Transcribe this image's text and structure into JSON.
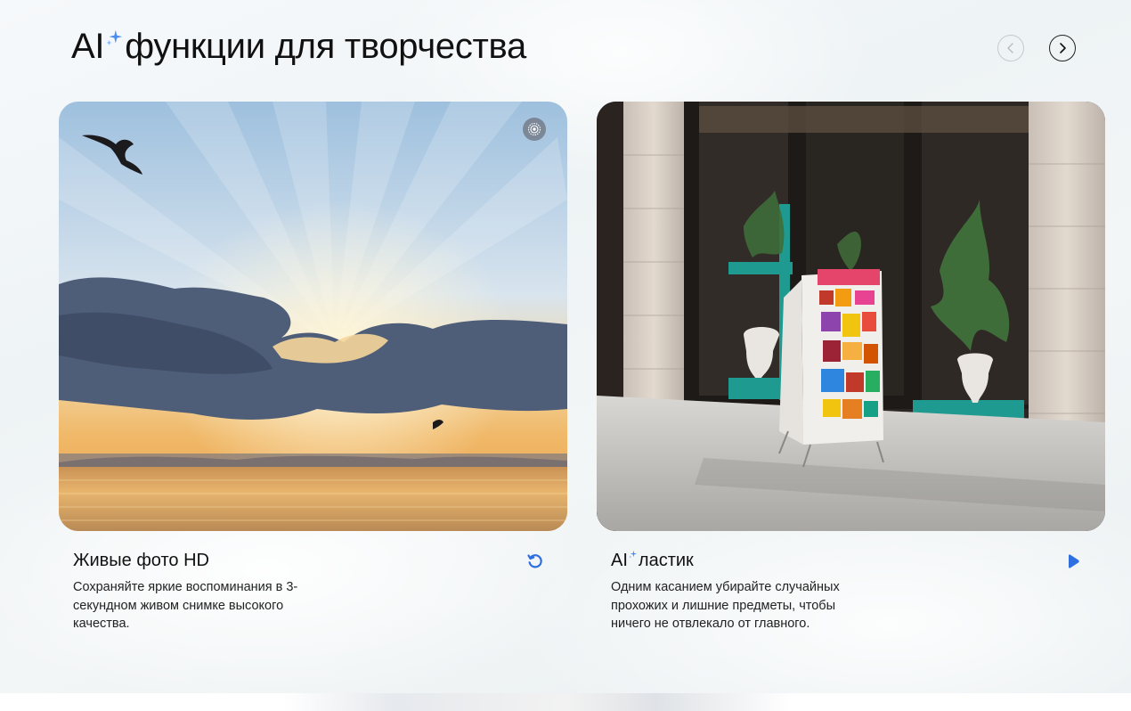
{
  "header": {
    "title_prefix": "AI",
    "title_main": "функции для творчества",
    "prev_label": "‹",
    "next_label": "›"
  },
  "cards": [
    {
      "title": "Живые фото HD",
      "description": "Сохраняйте яркие воспоминания в 3-секундном живом снимке высокого качества.",
      "media_icon": "live-photo-icon",
      "action_icon": "replay-icon"
    },
    {
      "title_prefix": "AI",
      "title_main": "ластик",
      "description": "Одним касанием убирайте случайных прохожих и лишние предметы, чтобы ничего не отвлекало от главного.",
      "action_icon": "play-icon"
    }
  ],
  "colors": {
    "accent": "#2f6fe0",
    "sparkle": "#4a8cf0",
    "text": "#111111"
  }
}
